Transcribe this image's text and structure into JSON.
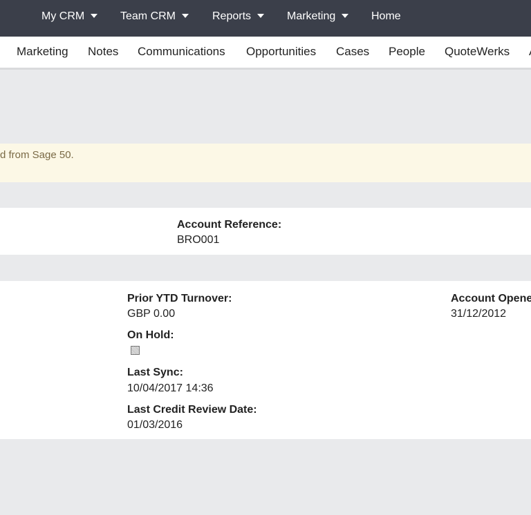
{
  "top_nav": {
    "items": [
      {
        "label": "My CRM",
        "has_dropdown": true
      },
      {
        "label": "Team CRM",
        "has_dropdown": true
      },
      {
        "label": "Reports",
        "has_dropdown": true
      },
      {
        "label": "Marketing",
        "has_dropdown": true
      },
      {
        "label": "Home",
        "has_dropdown": false
      }
    ]
  },
  "sub_nav": {
    "items": [
      "Marketing",
      "Notes",
      "Communications",
      "Opportunities",
      "Cases",
      "People",
      "QuoteWerks",
      "A"
    ]
  },
  "alert": {
    "text": "d from Sage 50."
  },
  "account_panel": {
    "reference_label": "Account Reference:",
    "reference_value": "BRO001"
  },
  "details_panel": {
    "prior_ytd_label": "Prior YTD Turnover:",
    "prior_ytd_value": "GBP 0.00",
    "on_hold_label": "On Hold:",
    "on_hold_checked": false,
    "last_sync_label": "Last Sync:",
    "last_sync_value": "10/04/2017 14:36",
    "last_credit_label": "Last Credit Review Date:",
    "last_credit_value": "01/03/2016",
    "account_opened_label": "Account Opene",
    "account_opened_value": "31/12/2012"
  },
  "colors": {
    "topbar": "#3b3f4a",
    "background": "#e9eaec",
    "alert_bg": "#fcf8e6",
    "alert_text": "#7a6a45"
  }
}
